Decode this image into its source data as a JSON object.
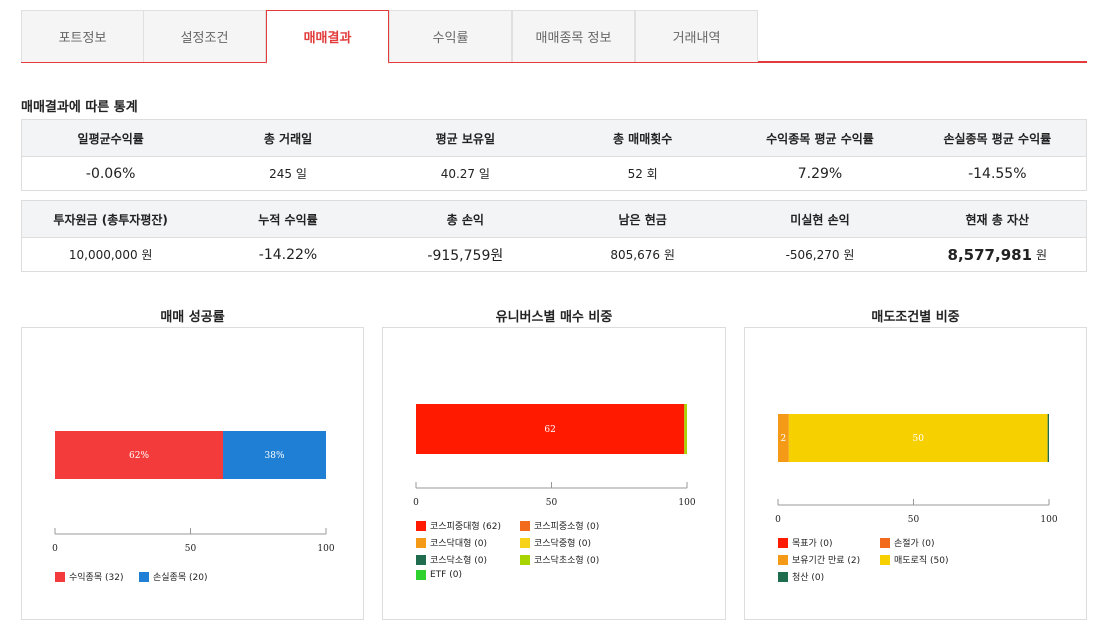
{
  "tabs": [
    {
      "label": "포트정보",
      "active": false
    },
    {
      "label": "설정조건",
      "active": false
    },
    {
      "label": "매매결과",
      "active": true
    },
    {
      "label": "수익률",
      "active": false
    },
    {
      "label": "매매종목 정보",
      "active": false
    },
    {
      "label": "거래내역",
      "active": false
    }
  ],
  "section_title": "매매결과에 따른 통계",
  "table1": {
    "headers": [
      "일평균수익률",
      "총 거래일",
      "평균 보유일",
      "총 매매횟수",
      "수익종목 평균 수익률",
      "손실종목 평균 수익률"
    ],
    "values": [
      "-0.06%",
      "245 일",
      "40.27 일",
      "52 회",
      "7.29%",
      "-14.55%"
    ]
  },
  "table2": {
    "headers": [
      "투자원금 (총투자평잔)",
      "누적 수익률",
      "총 손익",
      "남은 현금",
      "미실현 손익",
      "현재 총 자산"
    ],
    "values": [
      "10,000,000 원",
      "-14.22%",
      "-915,759원",
      "805,676 원",
      "-506,270 원",
      "8,577,981"
    ],
    "total_asset_unit": "원"
  },
  "colors": {
    "accent": "#e23b3b",
    "blue": "#2a75c8"
  },
  "chart_data": [
    {
      "type": "bar",
      "title": "매매 성공률",
      "orientation": "horizontal-stacked",
      "xlim": [
        0,
        100
      ],
      "ticks": [
        "0",
        "50",
        "100"
      ],
      "series": [
        {
          "name": "수익종목 (32)",
          "value": 62,
          "label": "62%",
          "color": "#f33b3b"
        },
        {
          "name": "손실종목 (20)",
          "value": 38,
          "label": "38%",
          "color": "#1f7fd4"
        }
      ]
    },
    {
      "type": "bar",
      "title": "유니버스별 매수 비중",
      "orientation": "horizontal-stacked",
      "xlim": [
        0,
        100
      ],
      "ticks": [
        "0",
        "50",
        "100"
      ],
      "series": [
        {
          "name": "코스피중대형 (62)",
          "value": 99,
          "label": "62",
          "color": "#ff1a00"
        },
        {
          "name": "코스피중소형 (0)",
          "value": 0,
          "label": "",
          "color": "#f26b1d"
        },
        {
          "name": "코스닥대형 (0)",
          "value": 0,
          "label": "",
          "color": "#f59a16"
        },
        {
          "name": "코스닥중형 (0)",
          "value": 0,
          "label": "",
          "color": "#f7d21a"
        },
        {
          "name": "코스닥소형 (0)",
          "value": 0,
          "label": "",
          "color": "#1f6d4e"
        },
        {
          "name": "코스닥초소형 (0)",
          "value": 1,
          "label": "",
          "color": "#a8d400"
        },
        {
          "name": "ETF (0)",
          "value": 0,
          "label": "",
          "color": "#2ed12e"
        }
      ]
    },
    {
      "type": "bar",
      "title": "매도조건별 비중",
      "orientation": "horizontal-stacked",
      "xlim": [
        0,
        100
      ],
      "ticks": [
        "0",
        "50",
        "100"
      ],
      "series": [
        {
          "name": "목표가 (0)",
          "value": 0,
          "label": "",
          "color": "#ff1a00"
        },
        {
          "name": "손절가 (0)",
          "value": 0,
          "label": "",
          "color": "#f26b1d"
        },
        {
          "name": "보유기간 만료 (2)",
          "value": 4,
          "label": "2",
          "color": "#f59a16"
        },
        {
          "name": "매도로직 (50)",
          "value": 95.5,
          "label": "50",
          "color": "#f7d000"
        },
        {
          "name": "청산 (0)",
          "value": 0.5,
          "label": "",
          "color": "#1f6d4e"
        }
      ]
    }
  ]
}
